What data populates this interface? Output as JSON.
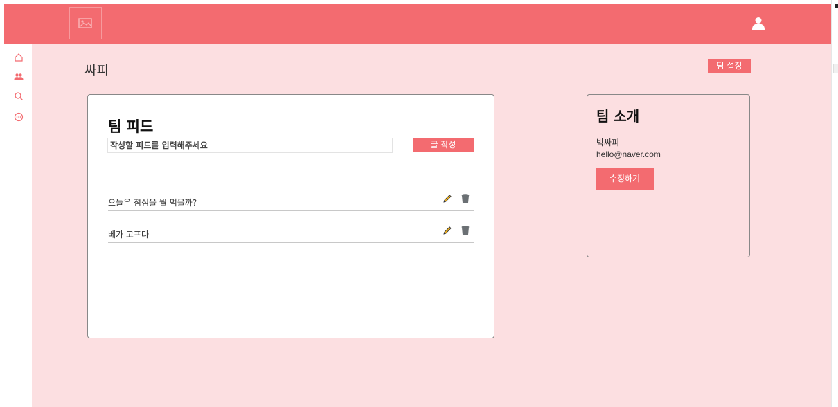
{
  "colors": {
    "accent": "#f36b70",
    "background": "#fcdfe1"
  },
  "header": {
    "logo_icon": "image-icon",
    "user_icon": "user-icon"
  },
  "sidebar": {
    "items": [
      {
        "icon": "home-icon"
      },
      {
        "icon": "users-icon",
        "active": true
      },
      {
        "icon": "search-icon"
      },
      {
        "icon": "chat-icon"
      }
    ]
  },
  "page": {
    "title": "싸피",
    "settings_label": "팀 설정"
  },
  "feed": {
    "title": "팀 피드",
    "input_placeholder": "작성할 피드를 입력해주세요",
    "write_label": "글 작성",
    "items": [
      {
        "text": "오늘은 점심을 뭘 먹을까?"
      },
      {
        "text": "베가 고프다"
      }
    ]
  },
  "intro": {
    "title": "팀 소개",
    "name": "박싸피",
    "email": "hello@naver.com",
    "edit_label": "수정하기"
  }
}
